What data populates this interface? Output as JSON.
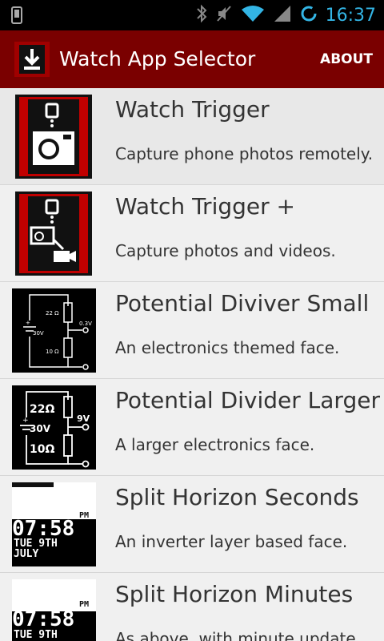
{
  "status_bar": {
    "time": "16:37",
    "icons": [
      "phone-icon",
      "bluetooth-icon",
      "mute-icon",
      "wifi-icon",
      "signal-icon",
      "sync-icon"
    ]
  },
  "action_bar": {
    "title": "Watch App Selector",
    "about_label": "ABOUT",
    "icon": "download-icon"
  },
  "colors": {
    "action_bar": "#7a0000",
    "status_time": "#33b5e5",
    "background": "#f0f0f0"
  },
  "apps": [
    {
      "title": "Watch Trigger",
      "description": "Capture phone photos remotely.",
      "thumb": "watch-trigger-thumb"
    },
    {
      "title": "Watch Trigger +",
      "description": "Capture photos and videos.",
      "thumb": "watch-trigger-plus-thumb"
    },
    {
      "title": "Potential Diviver Small",
      "description": "An electronics themed face.",
      "thumb": "divider-small-thumb"
    },
    {
      "title": "Potential Divider Larger",
      "description": "A larger electronics face.",
      "thumb": "divider-large-thumb"
    },
    {
      "title": "Split Horizon Seconds",
      "description": "An inverter layer based face.",
      "thumb": "split-horizon-seconds-thumb"
    },
    {
      "title": "Split Horizon Minutes",
      "description": "As above, with minute update",
      "thumb": "split-horizon-minutes-thumb"
    }
  ],
  "thumb_text": {
    "divider_small": {
      "r1": "22 Ω",
      "r2": "10 Ω",
      "vin": "30V",
      "vout": "0.3V"
    },
    "divider_large": {
      "r1": "22Ω",
      "r2": "10Ω",
      "vin": "30V",
      "vout": "9V"
    },
    "split": {
      "time": "07:58",
      "ampm": "PM",
      "day": "TUE 9TH",
      "month": "JULY"
    }
  }
}
